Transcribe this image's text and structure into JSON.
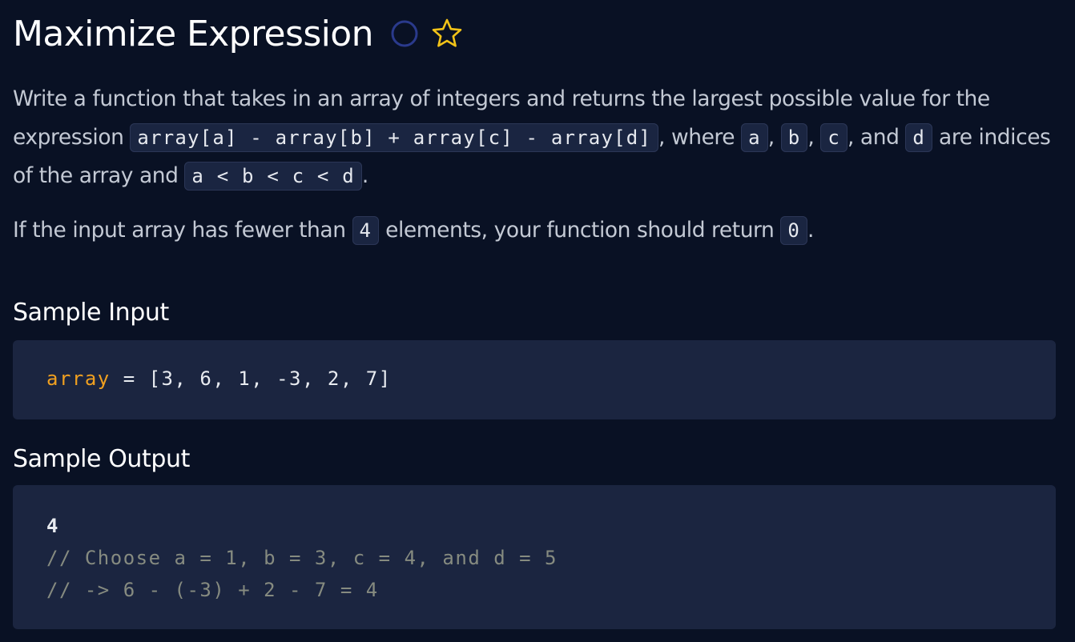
{
  "problem": {
    "title": "Maximize Expression",
    "status_icon": "circle-icon",
    "favorite_icon": "star-icon"
  },
  "description": {
    "p1_text1": "Write a function that takes in an array of integers and returns the largest possible value for the expression ",
    "p1_code_expr": "array[a] - array[b] + array[c] - array[d]",
    "p1_text2": ", where ",
    "p1_code_a": "a",
    "p1_sep1": ", ",
    "p1_code_b": "b",
    "p1_sep2": ", ",
    "p1_code_c": "c",
    "p1_text3": ", and ",
    "p1_code_d": "d",
    "p1_text4": " are indices of the array and ",
    "p1_code_order": "a < b < c < d",
    "p1_text5": ".",
    "p2_text1": "If the input array has fewer than ",
    "p2_code_count": "4",
    "p2_text2": " elements, your function should return ",
    "p2_code_zero": "0",
    "p2_text3": "."
  },
  "sample_input": {
    "label": "Sample Input",
    "var_name": "array",
    "assign": " = ",
    "value": "[3, 6, 1, -3, 2, 7]"
  },
  "sample_output": {
    "label": "Sample Output",
    "result": "4",
    "comment1": "// Choose a = 1, b = 3, c = 4, and d = 5",
    "comment2": "// -> 6 - (-3) + 2 - 7 = 4"
  },
  "colors": {
    "background": "#091124",
    "code_background": "#1b2540",
    "variable": "#f0a020",
    "comment": "#868b80",
    "star": "#f2c318"
  }
}
